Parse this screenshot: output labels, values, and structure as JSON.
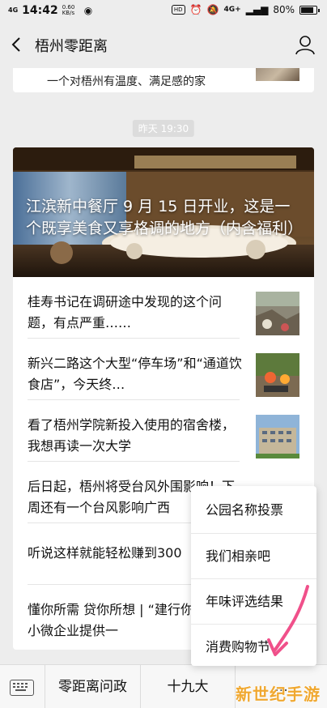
{
  "status": {
    "network_left": "4G",
    "time": "14:42",
    "speed": "0.60 KB/s",
    "hd_badge": "HD",
    "network_right": "4G+",
    "battery": "80%"
  },
  "navbar": {
    "title": "梧州零距离"
  },
  "feed": {
    "previous_snippet": "一个对梧州有温度、满足感的家",
    "timestamp": "昨天 19:30",
    "hero_title": "江滨新中餐厅 9 月 15 日开业，这是一个既享美食又享格调的地方（内含福利）",
    "items": [
      {
        "text": "桂寿书记在调研途中发现的这个问题，有点严重……"
      },
      {
        "text": "新兴二路这个大型“停车场”和“通道饮食店”，今天终…"
      },
      {
        "text": "看了梧州学院新投入使用的宿舍楼，我想再读一次大学"
      },
      {
        "text": "后日起，梧州将受台风外围影响！下周还有一个台风影响广西"
      },
      {
        "text": "听说这样就能轻松赚到300"
      },
      {
        "text": "懂你所需 贷你所想 | “建行你”APP为小微企业提供一"
      }
    ]
  },
  "popup_menu": {
    "items": [
      "公园名称投票",
      "我们相亲吧",
      "年味评选结果",
      "消费购物节"
    ]
  },
  "bottom_menu": {
    "tabs": [
      "零距离问政",
      "十九大",
      "..."
    ],
    "watermark": "新世纪手游"
  },
  "icons": {
    "back": "chevron-left-icon",
    "person": "person-icon",
    "keyboard": "keyboard-icon"
  }
}
